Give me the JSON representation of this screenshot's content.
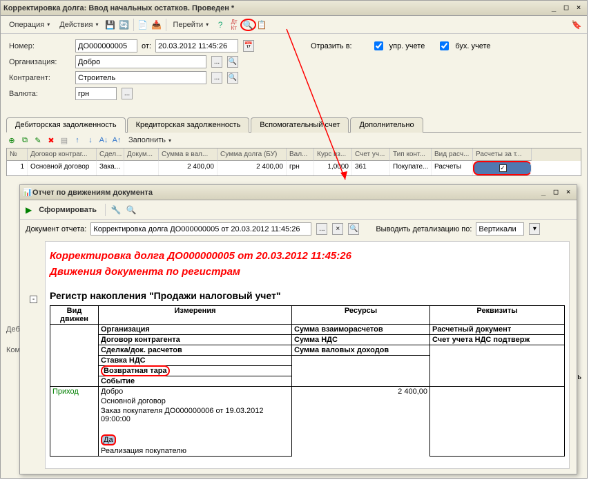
{
  "main": {
    "title": "Корректировка долга: Ввод начальных остатков. Проведен *",
    "toolbar": {
      "operation": "Операция",
      "actions": "Действия",
      "goto": "Перейти"
    },
    "form": {
      "number_label": "Номер:",
      "number_value": "ДО000000005",
      "from_label": "от:",
      "date_value": "20.03.2012 11:45:26",
      "reflect_label": "Отразить в:",
      "upr_label": "упр. учете",
      "buh_label": "бух. учете",
      "org_label": "Организация:",
      "org_value": "Добро",
      "contr_label": "Контрагент:",
      "contr_value": "Строитель",
      "currency_label": "Валюта:",
      "currency_value": "грн"
    },
    "tabs": {
      "t1": "Дебиторская задолженность",
      "t2": "Кредиторская задолженность",
      "t3": "Вспомогательный счет",
      "t4": "Дополнительно"
    },
    "grid_toolbar": {
      "fill": "Заполнить"
    },
    "grid": {
      "headers": {
        "n": "№",
        "dogovor": "Договор контраг...",
        "sdel": "Сдел...",
        "dokum": "Докум...",
        "sum_val": "Сумма в вал...",
        "sum_dolg": "Сумма долга (БУ)",
        "val": "Вал...",
        "kurs": "Курс вз...",
        "schet": "Счет уч...",
        "tip": "Тип конт...",
        "vid": "Вид расч...",
        "raschety": "Расчеты за т..."
      },
      "row": {
        "n": "1",
        "dogovor": "Основной договор",
        "sdel": "Зака...",
        "sum_val": "2 400,00",
        "sum_dolg": "2 400,00",
        "val": "грн",
        "kurs": "1,0000",
        "schet": "361",
        "tip": "Покупате...",
        "vid": "Расчеты"
      }
    },
    "bottom": {
      "deb": "Деб",
      "kom": "Ком",
      "close": "крыть"
    }
  },
  "sub": {
    "title": "Отчет по движениям документа",
    "toolbar": {
      "form_btn": "Сформировать"
    },
    "doc_line": {
      "label": "Документ отчета:",
      "value": "Корректировка долга ДО000000005 от 20.03.2012 11:45:26",
      "detail_label": "Выводить детализацию по:",
      "detail_value": "Вертикали"
    },
    "report": {
      "title1": "Корректировка долга ДО000000005 от 20.03.2012 11:45:26",
      "title2": "Движения документа по регистрам",
      "register": "Регистр накопления \"Продажи налоговый учет\"",
      "headers": {
        "vid": "Вид движен",
        "izm": "Измерения",
        "res": "Ресурсы",
        "rekv": "Реквизиты"
      },
      "rows": {
        "org": "Организация",
        "dog": "Договор контрагента",
        "sdel": "Сделка/док. расчетов",
        "stavka": "Ставка НДС",
        "tara": "Возвратная тара",
        "sobytie": "Событие",
        "sum_vz": "Сумма взаиморасчетов",
        "sum_nds": "Сумма НДС",
        "sum_val": "Сумма валовых доходов",
        "rasch_doc": "Расчетный документ",
        "schet_nds": "Счет учета НДС подтверж"
      },
      "data": {
        "prihod": "Приход",
        "dobro": "Добро",
        "osn_dog": "Основной договор",
        "zakaz": "Заказ покупателя ДО000000006 от 19.03.2012 09:00:00",
        "da": "Да",
        "realiz": "Реализация покупателю",
        "sum": "2 400,00"
      }
    }
  }
}
